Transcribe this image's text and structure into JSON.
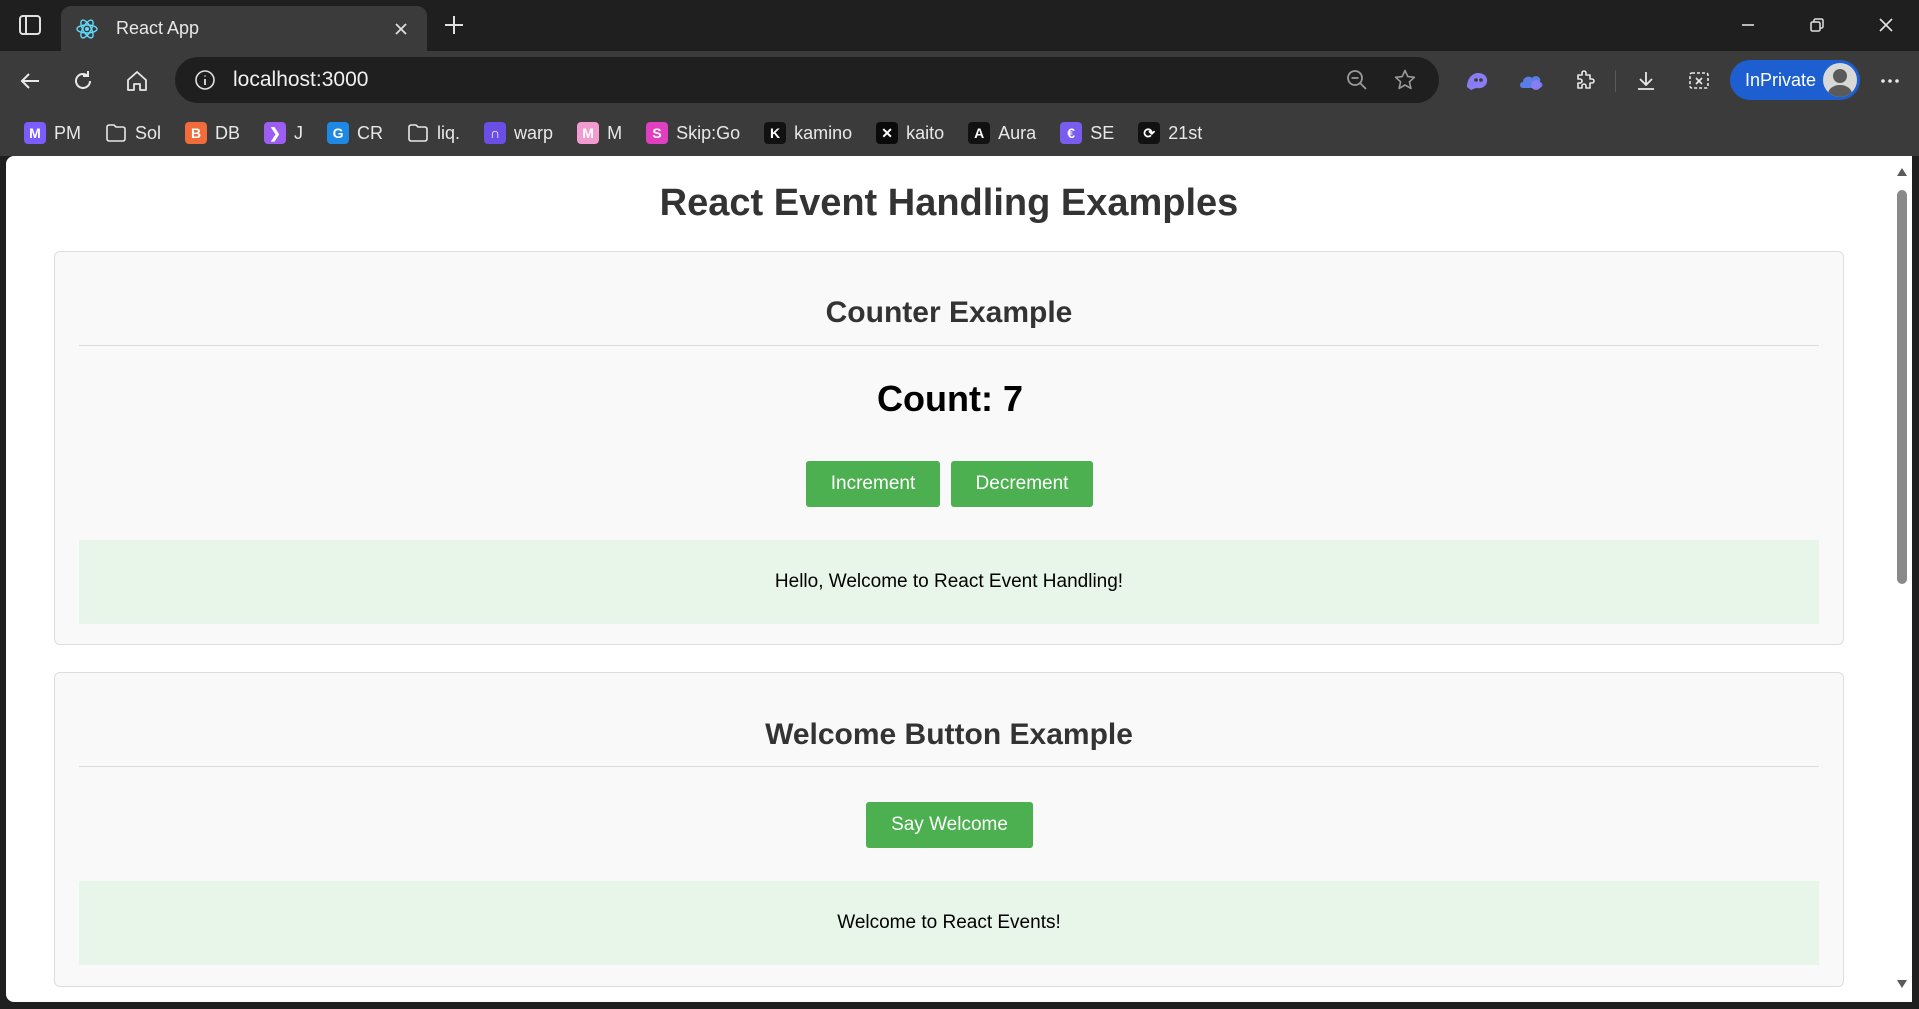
{
  "browser": {
    "tab": {
      "title": "React App"
    },
    "address": {
      "url": "localhost:3000"
    },
    "inprivate_label": "InPrivate",
    "bookmarks": [
      {
        "label": "PM",
        "icon": "gmail-icon",
        "color": "#7b5cff",
        "glyph": "M"
      },
      {
        "label": "Sol",
        "icon": "folder-icon",
        "color": "",
        "glyph": ""
      },
      {
        "label": "DB",
        "icon": "db-icon",
        "color": "#f26b3a",
        "glyph": "B"
      },
      {
        "label": "J",
        "icon": "jupiter-icon",
        "color": "#9d5cf2",
        "glyph": "❯"
      },
      {
        "label": "CR",
        "icon": "cr-icon",
        "color": "#1e88e5",
        "glyph": "G"
      },
      {
        "label": "liq.",
        "icon": "folder-icon",
        "color": "",
        "glyph": ""
      },
      {
        "label": "warp",
        "icon": "warp-icon",
        "color": "#6b4ee6",
        "glyph": "∩"
      },
      {
        "label": "M",
        "icon": "m-icon",
        "color": "#f29bd0",
        "glyph": "M"
      },
      {
        "label": "Skip:Go",
        "icon": "skipgo-icon",
        "color": "#e040c0",
        "glyph": "S"
      },
      {
        "label": "kamino",
        "icon": "kamino-icon",
        "color": "#111111",
        "glyph": "K"
      },
      {
        "label": "kaito",
        "icon": "kaito-icon",
        "color": "#0a0a0a",
        "glyph": "✕"
      },
      {
        "label": "Aura",
        "icon": "aura-icon",
        "color": "#111111",
        "glyph": "A"
      },
      {
        "label": "SE",
        "icon": "se-icon",
        "color": "#7a5cf0",
        "glyph": "€"
      },
      {
        "label": "21st",
        "icon": "21st-icon",
        "color": "#111111",
        "glyph": "⟳"
      }
    ]
  },
  "page": {
    "title": "React Event Handling Examples",
    "counter": {
      "heading": "Counter Example",
      "count_text": "Count: 7",
      "increment_label": "Increment",
      "decrement_label": "Decrement",
      "message": "Hello, Welcome to React Event Handling!"
    },
    "welcome": {
      "heading": "Welcome Button Example",
      "button_label": "Say Welcome",
      "message": "Welcome to React Events!"
    }
  },
  "colors": {
    "accent_button": "#4caf50",
    "message_bg": "#e8f5e9",
    "inprivate": "#1d5fd0"
  }
}
